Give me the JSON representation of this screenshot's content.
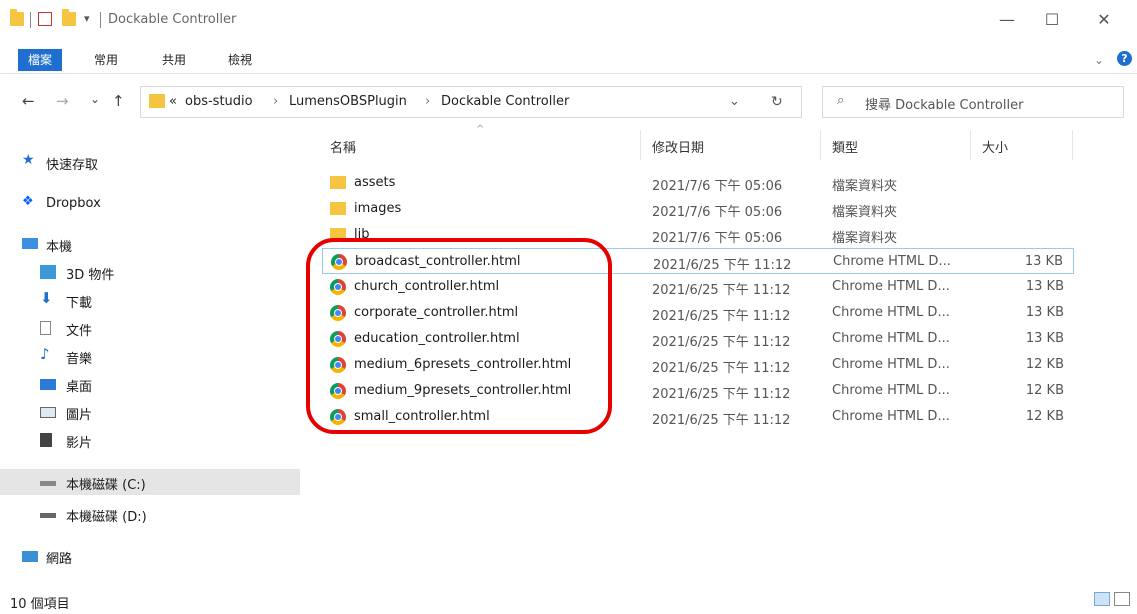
{
  "window": {
    "title": "Dockable Controller",
    "minimize": "—",
    "maximize": "☐",
    "close": "✕"
  },
  "ribbon": {
    "tabs": [
      "檔案",
      "常用",
      "共用",
      "檢視"
    ],
    "collapse": "⌄",
    "help": "?"
  },
  "nav": {
    "back": "←",
    "forward": "→",
    "recent": "⌄",
    "up": "↑",
    "breadcrumb": [
      "«",
      "obs-studio",
      "›",
      "LumensOBSPlugin",
      "›",
      "Dockable Controller"
    ],
    "dropdown": "⌄",
    "refresh": "↻",
    "search_placeholder": "搜尋 Dockable Controller",
    "search_icon": "⌕"
  },
  "sidebar": {
    "items": [
      {
        "label": "快速存取",
        "icon": "star-icon"
      },
      {
        "label": "Dropbox",
        "icon": "dropbox-icon"
      },
      {
        "label": "本機",
        "icon": "computer-icon"
      },
      {
        "label": "3D 物件",
        "icon": "3d-objects-icon"
      },
      {
        "label": "下載",
        "icon": "download-icon"
      },
      {
        "label": "文件",
        "icon": "document-icon"
      },
      {
        "label": "音樂",
        "icon": "music-icon"
      },
      {
        "label": "桌面",
        "icon": "desktop-icon"
      },
      {
        "label": "圖片",
        "icon": "pictures-icon"
      },
      {
        "label": "影片",
        "icon": "video-icon"
      },
      {
        "label": "本機磁碟 (C:)",
        "icon": "drive-c-icon"
      },
      {
        "label": "本機磁碟 (D:)",
        "icon": "drive-d-icon"
      },
      {
        "label": "網路",
        "icon": "network-icon"
      }
    ]
  },
  "columns": {
    "name": "名稱",
    "date": "修改日期",
    "type": "類型",
    "size": "大小",
    "sort_indicator": "^"
  },
  "files": [
    {
      "name": "assets",
      "date": "2021/7/6 下午 05:06",
      "type": "檔案資料夾",
      "size": "",
      "icon": "folder-icon"
    },
    {
      "name": "images",
      "date": "2021/7/6 下午 05:06",
      "type": "檔案資料夾",
      "size": "",
      "icon": "folder-icon"
    },
    {
      "name": "lib",
      "date": "2021/7/6 下午 05:06",
      "type": "檔案資料夾",
      "size": "",
      "icon": "folder-icon"
    },
    {
      "name": "broadcast_controller.html",
      "date": "2021/6/25 下午 11:12",
      "type": "Chrome HTML D...",
      "size": "13 KB",
      "icon": "chrome-icon"
    },
    {
      "name": "church_controller.html",
      "date": "2021/6/25 下午 11:12",
      "type": "Chrome HTML D...",
      "size": "13 KB",
      "icon": "chrome-icon"
    },
    {
      "name": "corporate_controller.html",
      "date": "2021/6/25 下午 11:12",
      "type": "Chrome HTML D...",
      "size": "13 KB",
      "icon": "chrome-icon"
    },
    {
      "name": "education_controller.html",
      "date": "2021/6/25 下午 11:12",
      "type": "Chrome HTML D...",
      "size": "13 KB",
      "icon": "chrome-icon"
    },
    {
      "name": "medium_6presets_controller.html",
      "date": "2021/6/25 下午 11:12",
      "type": "Chrome HTML D...",
      "size": "12 KB",
      "icon": "chrome-icon"
    },
    {
      "name": "medium_9presets_controller.html",
      "date": "2021/6/25 下午 11:12",
      "type": "Chrome HTML D...",
      "size": "12 KB",
      "icon": "chrome-icon"
    },
    {
      "name": "small_controller.html",
      "date": "2021/6/25 下午 11:12",
      "type": "Chrome HTML D...",
      "size": "12 KB",
      "icon": "chrome-icon"
    }
  ],
  "status": {
    "count": "10 個項目"
  },
  "colors": {
    "accent": "#1e6fd0",
    "highlight": "#e60000",
    "folder": "#f5c542"
  }
}
